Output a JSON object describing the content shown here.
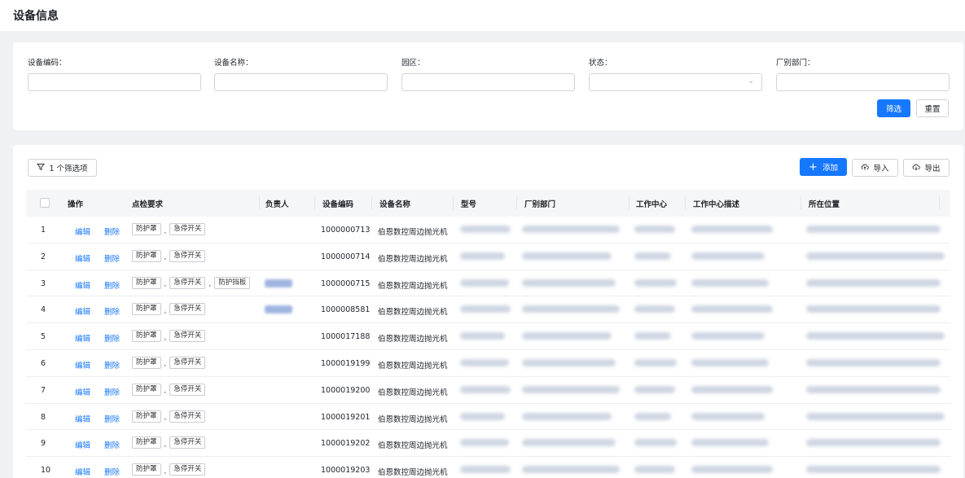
{
  "page": {
    "title": "设备信息"
  },
  "filters": {
    "fields": [
      {
        "label": "设备编码：",
        "value": "",
        "type": "input"
      },
      {
        "label": "设备名称：",
        "value": "",
        "type": "input"
      },
      {
        "label": "园区：",
        "value": "",
        "type": "input"
      },
      {
        "label": "状态：",
        "value": "",
        "type": "select"
      },
      {
        "label": "厂别部门：",
        "value": "",
        "type": "input"
      }
    ],
    "search_label": "筛选",
    "reset_label": "重置"
  },
  "toolbar": {
    "filter_count_label": "1 个筛选项",
    "add_label": "添加",
    "import_label": "导入",
    "export_label": "导出"
  },
  "table": {
    "columns": [
      "操作",
      "点检要求",
      "负责人",
      "设备编码",
      "设备名称",
      "型号",
      "厂别部门",
      "工作中心",
      "工作中心描述",
      "所在位置"
    ],
    "edit_label": "编辑",
    "delete_label": "删除",
    "tag_separator": ",",
    "rows": [
      {
        "index": "1",
        "tags": [
          "防护罩",
          "急停开关"
        ],
        "owner": "",
        "code": "1000000713",
        "name": "伯恩数控周边抛光机"
      },
      {
        "index": "2",
        "tags": [
          "防护罩",
          "急停开关"
        ],
        "owner": "",
        "code": "1000000714",
        "name": "伯恩数控周边抛光机"
      },
      {
        "index": "3",
        "tags": [
          "防护罩",
          "急停开关",
          "防护挡板"
        ],
        "owner": "blurred",
        "code": "1000000715",
        "name": "伯恩数控周边抛光机"
      },
      {
        "index": "4",
        "tags": [
          "防护罩",
          "急停开关"
        ],
        "owner": "blurred",
        "code": "1000008581",
        "name": "伯恩数控周边抛光机"
      },
      {
        "index": "5",
        "tags": [
          "防护罩",
          "急停开关"
        ],
        "owner": "",
        "code": "1000017188",
        "name": "伯恩数控周边抛光机"
      },
      {
        "index": "6",
        "tags": [
          "防护罩",
          "急停开关"
        ],
        "owner": "",
        "code": "1000019199",
        "name": "伯恩数控周边抛光机"
      },
      {
        "index": "7",
        "tags": [
          "防护罩",
          "急停开关"
        ],
        "owner": "",
        "code": "1000019200",
        "name": "伯恩数控周边抛光机"
      },
      {
        "index": "8",
        "tags": [
          "防护罩",
          "急停开关"
        ],
        "owner": "",
        "code": "1000019201",
        "name": "伯恩数控周边抛光机"
      },
      {
        "index": "9",
        "tags": [
          "防护罩",
          "急停开关"
        ],
        "owner": "",
        "code": "1000019202",
        "name": "伯恩数控周边抛光机"
      },
      {
        "index": "10",
        "tags": [
          "防护罩",
          "急停开关"
        ],
        "owner": "",
        "code": "1000019203",
        "name": "伯恩数控周边抛光机"
      }
    ]
  },
  "colors": {
    "primary": "#1677ff",
    "header_bg": "#f5f6f8",
    "page_bg": "#f0f1f4"
  }
}
